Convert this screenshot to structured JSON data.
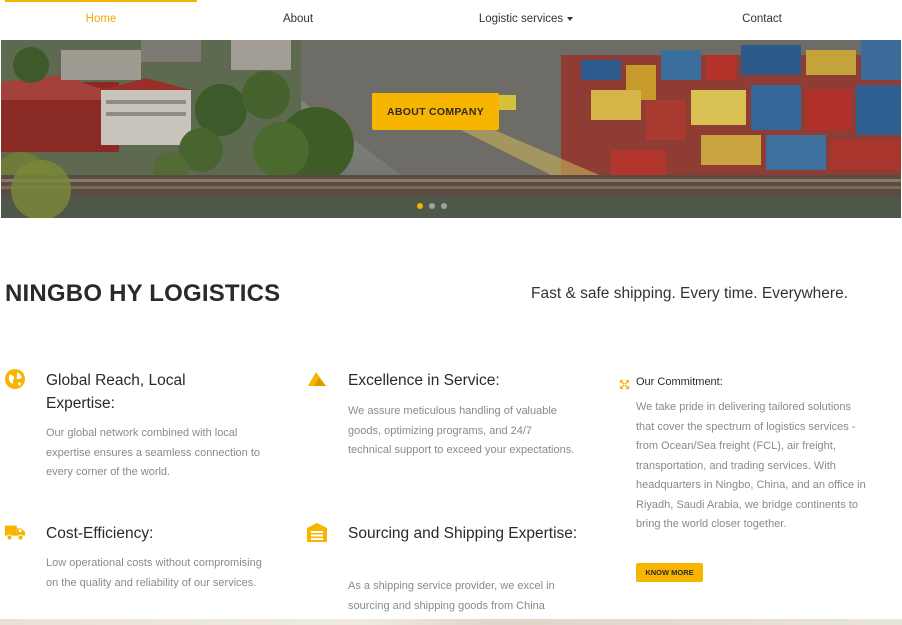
{
  "nav": {
    "items": [
      {
        "label": "Home",
        "active": true
      },
      {
        "label": "About",
        "active": false
      },
      {
        "label": "Logistic services",
        "active": false,
        "has_dropdown": true
      },
      {
        "label": "Contact",
        "active": false
      }
    ]
  },
  "hero": {
    "button_label": "ABOUT COMPANY",
    "slide_count": 3,
    "active_slide": 1
  },
  "intro": {
    "title": "NINGBO HY LOGISTICS",
    "tagline": "Fast & safe shipping. Every time. Everywhere."
  },
  "features": [
    {
      "icon": "globe-icon",
      "title": "Global Reach, Local Expertise:",
      "text": "Our global network combined with local expertise ensures a seamless connection to every corner of the world."
    },
    {
      "icon": "paper-plane-icon",
      "title": "Excellence in Service:",
      "text": "We assure meticulous handling of valuable goods, optimizing programs, and 24/7 technical support to exceed your expectations."
    },
    {
      "icon": "truck-icon",
      "title": "Cost-Efficiency:",
      "text": "Low operational costs without compromising on the quality and reliability of our services."
    },
    {
      "icon": "warehouse-icon",
      "title": "Sourcing and Shipping Expertise:",
      "text": "As a shipping service provider, we excel in sourcing and shipping goods from China"
    }
  ],
  "commitment": {
    "icon": "arrows-expand-icon",
    "title": "Our Commitment:",
    "text": "We take pride in delivering tailored solutions that cover the spectrum of logistics services - from Ocean/Sea freight (FCL), air freight, transportation, and trading services. With headquarters in Ningbo, China, and an office in Riyadh, Saudi Arabia, we bridge continents to bring the world closer together.",
    "button_label": "KNOW MORE"
  },
  "colors": {
    "accent": "#f7b500",
    "heading": "#2a2a2a",
    "body_text": "#8a8a8a"
  }
}
